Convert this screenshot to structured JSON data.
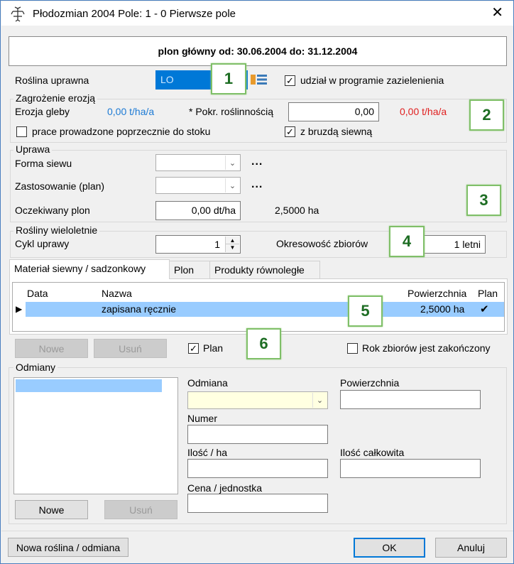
{
  "window": {
    "title": "Płodozmian 2004 Pole: 1 - 0 Pierwsze pole",
    "close_glyph": "✕"
  },
  "header": {
    "text": "plon główny od: 30.06.2004 do: 31.12.2004"
  },
  "crop": {
    "label": "Roślina uprawna",
    "value": "LO",
    "greening_label": "udział w programie zazielenienia",
    "greening_checked": "✓"
  },
  "erosion": {
    "group_title": "Zagrożenie erozją",
    "soil_label": "Erozja gleby",
    "soil_value": "0,00 t/ha/a",
    "cover_label": "* Pokr. roślinnością",
    "cover_value": "0,00",
    "result_value": "0,00 t/ha/a",
    "across_slope_label": "prace prowadzone poprzecznie do stoku",
    "across_slope_checked": "",
    "furrow_label": "z bruzdą siewną",
    "furrow_checked": "✓"
  },
  "cultivation": {
    "group_title": "Uprawa",
    "sowing_form_label": "Forma siewu",
    "application_label": "Zastosowanie (plan)",
    "dots": "...",
    "expected_yield_label": "Oczekiwany plon",
    "expected_yield_value": "0,00 dt/ha",
    "area_value": "2,5000 ha"
  },
  "perennial": {
    "group_title": "Rośliny wieloletnie",
    "cycle_label": "Cykl uprawy",
    "cycle_value": "1",
    "periodicity_label": "Okresowość zbiorów",
    "periodicity_value": "1 letni"
  },
  "tabs": [
    {
      "label": "Materiał siewny / sadzonkowy"
    },
    {
      "label": "Plon"
    },
    {
      "label": "Produkty równoległe"
    }
  ],
  "table": {
    "columns": [
      "Data",
      "Nazwa",
      "Powierzchnia",
      "Plan"
    ],
    "rows": [
      {
        "data": "",
        "nazwa": "zapisana ręcznie",
        "powierzchnia": "2,5000 ha",
        "plan": "✔"
      }
    ],
    "row_pointer": "▶"
  },
  "actions": {
    "new_label": "Nowe",
    "delete_label": "Usuń",
    "plan_label": "Plan",
    "plan_checked": "✓",
    "harvest_done_label": "Rok zbiorów jest zakończony",
    "harvest_done_checked": ""
  },
  "varieties": {
    "group_title": "Odmiany",
    "variety_label": "Odmiana",
    "area_label": "Powierzchnia",
    "number_label": "Numer",
    "qty_per_ha_label": "Ilość / ha",
    "qty_total_label": "Ilość całkowita",
    "price_label": "Cena / jednostka",
    "new_label": "Nowe",
    "delete_label": "Usuń"
  },
  "footer": {
    "new_plant_label": "Nowa roślina / odmiana",
    "ok_label": "OK",
    "cancel_label": "Anuluj"
  },
  "callouts": [
    "1",
    "2",
    "3",
    "4",
    "5",
    "6"
  ],
  "colors": {
    "accent": "#0078d7",
    "link_blue": "#1c7ad4",
    "alert_red": "#e02020",
    "selection": "#99ccff",
    "callout_border": "#7fbf68"
  }
}
